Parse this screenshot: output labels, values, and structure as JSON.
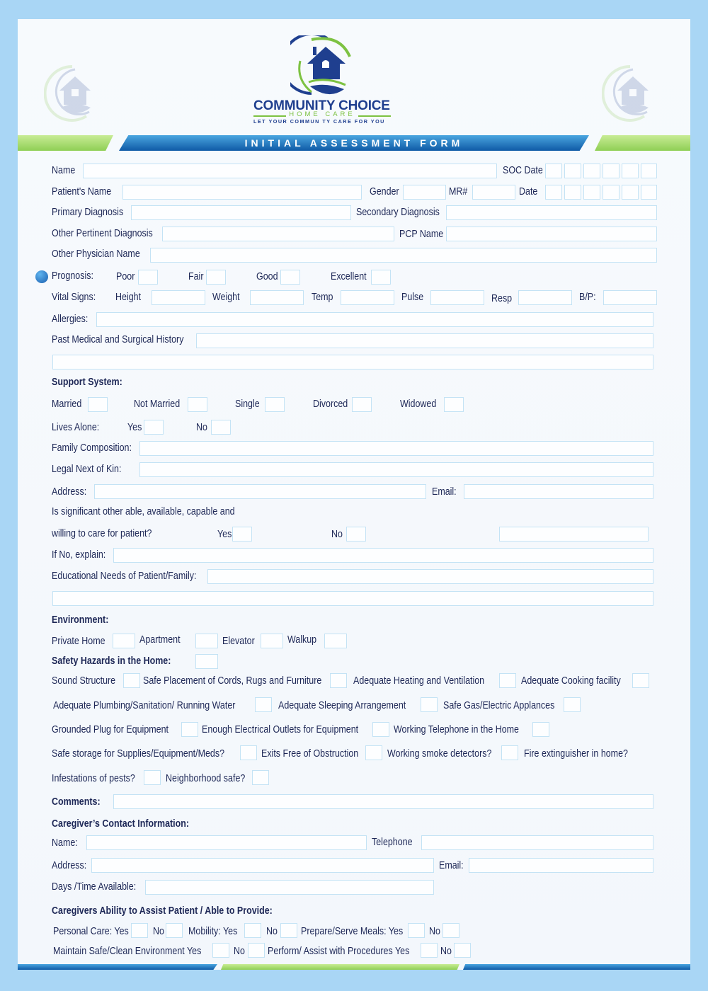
{
  "header": {
    "company_name": "COMMUNITY CHOICE",
    "company_sub": "HOME CARE",
    "tagline": "LET YOUR COMMUN TY CARE FOR YOU",
    "form_title": "INITIAL ASSESSMENT FORM",
    "colors": {
      "brand_blue": "#1f3f8f",
      "brand_green": "#7dc242",
      "banner_blue": "#1e6fb8",
      "page_bg": "#a9d6f5"
    }
  },
  "patient": {
    "name": "Name",
    "soc_date": "SOC Date",
    "patients_name": "Patient's Name",
    "gender": "Gender",
    "mr": "MR#",
    "date": "Date",
    "primary_diagnosis": "Primary Diagnosis",
    "secondary_diagnosis": "Secondary Diagnosis",
    "other_pertinent": "Other Pertinent Diagnosis",
    "pcp_name": "PCP Name",
    "other_physician": "Other Physician Name"
  },
  "prognosis": {
    "label": "Prognosis:",
    "options": [
      "Poor",
      "Fair",
      "Good",
      "Excellent"
    ]
  },
  "vitals": {
    "label": "Vital Signs:",
    "height": "Height",
    "weight": "Weight",
    "temp": "Temp",
    "pulse": "Pulse",
    "resp": "Resp",
    "bp": "B/P:"
  },
  "history": {
    "allergies": "Allergies:",
    "past_medical": "Past Medical and Surgical History"
  },
  "support": {
    "heading": "Support System:",
    "marital": [
      "Married",
      "Not Married",
      "Single",
      "Divorced",
      "Widowed"
    ],
    "lives_alone": "Lives Alone:",
    "yes": "Yes",
    "no": "No",
    "family_composition": "Family Composition:",
    "next_of_kin": "Legal Next of Kin:",
    "address": "Address:",
    "email": "Email:",
    "significant_other_1": "Is significant other able, available, capable and",
    "significant_other_2": "willing to care for patient?",
    "if_no": "If No, explain:",
    "educational_needs": "Educational Needs of Patient/Family:"
  },
  "environment": {
    "heading": "Environment:",
    "types": [
      "Private Home",
      "Apartment",
      "Elevator",
      "Walkup"
    ],
    "hazards_heading": "Safety Hazards in the Home:",
    "hazards": [
      "Sound Structure",
      "Safe Placement of Cords, Rugs and Furniture",
      "Adequate Heating and Ventilation",
      "Adequate Cooking facility",
      "Adequate Plumbing/Sanitation/ Running Water",
      "Adequate Sleeping  Arrangement",
      "Safe Gas/Electric Applances",
      "Grounded Plug for Equipment",
      "Enough Electrical Outlets for Equipment",
      "Working Telephone in the Home",
      "Safe storage for Supplies/Equipment/Meds?",
      "Exits Free of Obstruction",
      "Working smoke detectors?",
      "Fire extinguisher in home?",
      "Infestations of pests?",
      "Neighborhood safe?"
    ],
    "comments": "Comments:"
  },
  "caregiver": {
    "heading": "Caregiver’s Contact Information:",
    "name": "Name:",
    "telephone": "Telephone",
    "address": "Address:",
    "email": "Email:",
    "days_time": "Days /Time Available:",
    "ability_heading": "Caregivers Ability to Assist Patient / Able to Provide:",
    "personal_care": "Personal Care:  Yes",
    "mobility": "Mobility:  Yes",
    "meals": "Prepare/Serve Meals: Yes",
    "safe_env": "Maintain Safe/Clean Environment Yes",
    "procedures": "Perform/  Assist with Procedures Yes",
    "no": "No"
  }
}
